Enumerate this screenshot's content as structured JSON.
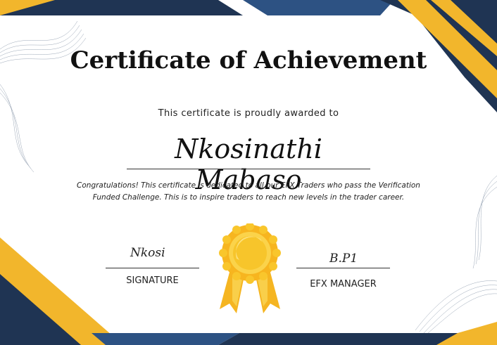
{
  "certificate": {
    "title": "Certificate of Achievement",
    "subtitle": "This certificate is proudly awarded to",
    "recipient": "Nkosinathi Mabaso",
    "message": "Congratulations! This certificate is dedicated to all our EFX Traders who pass the Verification Funded Challenge. This is to inspire traders to reach new levels in the trader career.",
    "left_signature": "Nkosi",
    "left_label": "SIGNATURE",
    "right_signature": "B.P1",
    "right_label": "EFX MANAGER"
  },
  "colors": {
    "navy": "#1f3453",
    "blue": "#2d5283",
    "gold": "#f2b62c",
    "medal_gold": "#f7c52b"
  },
  "icons": [
    "award-ribbon-icon"
  ]
}
